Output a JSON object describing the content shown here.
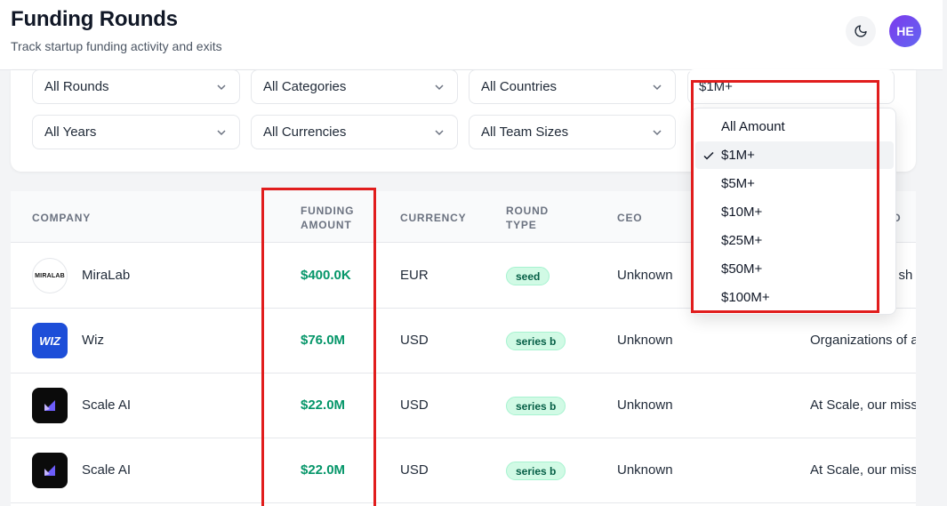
{
  "header": {
    "title": "Funding Rounds",
    "subtitle": "Track startup funding activity and exits",
    "avatar_initials": "HE"
  },
  "filters": {
    "rounds": "All Rounds",
    "categories": "All Categories",
    "countries": "All Countries",
    "amount": "$1M+",
    "years": "All Years",
    "currencies": "All Currencies",
    "team_sizes": "All Team Sizes"
  },
  "amount_dropdown": {
    "selected": "$1M+",
    "options": [
      "All Amount",
      "$1M+",
      "$5M+",
      "$10M+",
      "$25M+",
      "$50M+",
      "$100M+"
    ]
  },
  "table": {
    "headers": {
      "company": "COMPANY",
      "funding_amount_1": "FUNDING",
      "funding_amount_2": "AMOUNT",
      "currency": "CURRENCY",
      "round_type_1": "ROUND",
      "round_type_2": "TYPE",
      "ceo": "CEO",
      "description_partial": "D"
    },
    "rows": [
      {
        "company": "MiraLab",
        "logo_text": "MIRALAB",
        "amount": "$400.0K",
        "currency": "EUR",
        "round": "seed",
        "ceo": "Unknown",
        "description": "e sh"
      },
      {
        "company": "Wiz",
        "logo_text": "WIZ",
        "amount": "$76.0M",
        "currency": "USD",
        "round": "series b",
        "ceo": "Unknown",
        "description": "Organizations of a"
      },
      {
        "company": "Scale AI",
        "logo_text": "",
        "amount": "$22.0M",
        "currency": "USD",
        "round": "series b",
        "ceo": "Unknown",
        "description": "At Scale, our miss"
      },
      {
        "company": "Scale AI",
        "logo_text": "",
        "amount": "$22.0M",
        "currency": "USD",
        "round": "series b",
        "ceo": "Unknown",
        "description": "At Scale, our miss"
      }
    ]
  },
  "colors": {
    "amount_green": "#059669",
    "badge_bg": "#d1fae5",
    "annotation_red": "#e11d1d",
    "avatar_purple": "#7c3aed"
  },
  "icons": [
    "moon-icon",
    "chevron-down-icon",
    "check-icon",
    "miralab-logo",
    "wiz-logo",
    "scale-ai-logo"
  ]
}
